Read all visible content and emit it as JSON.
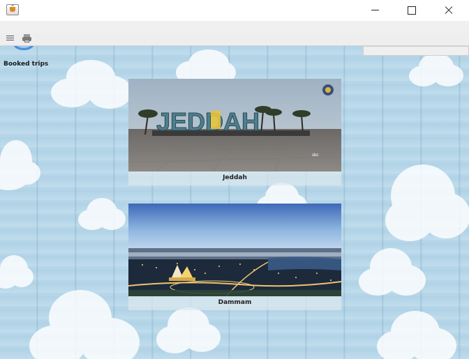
{
  "window": {
    "title": "",
    "buttons": {
      "minimize": "minimize",
      "maximize": "maximize",
      "close": "close"
    }
  },
  "toolbar": {
    "icons": [
      "list-icon",
      "printer-icon"
    ]
  },
  "sidebar": {
    "booked_trips_label": "Booked trips"
  },
  "trips": [
    {
      "name": "Jeddah",
      "photo_sign_text": "JEDDAH",
      "watermark": "sbc"
    },
    {
      "name": "Dammam"
    }
  ],
  "colors": {
    "background": "#b8d8ea",
    "card_overlay": "#dce8ee",
    "title_bar": "#ffffff",
    "toolbar": "#eeeeee"
  }
}
